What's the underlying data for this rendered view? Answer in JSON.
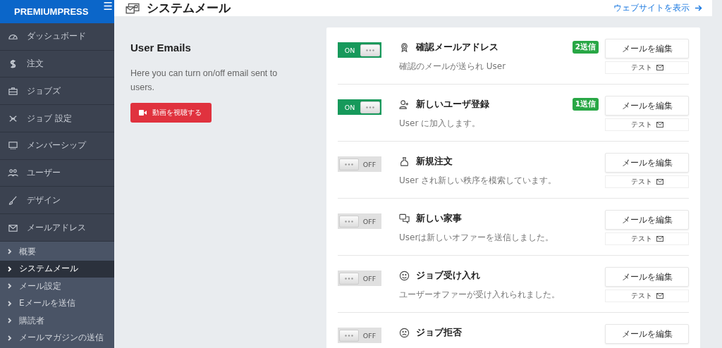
{
  "sidebar": {
    "logo": "PREMIUMPRESS",
    "menu_toggle": "☰",
    "items": [
      {
        "label": "ダッシュボード"
      },
      {
        "label": "注文"
      },
      {
        "label": "ジョブズ"
      },
      {
        "label": "ジョブ 設定"
      },
      {
        "label": "メンバーシップ"
      },
      {
        "label": "ユーザー"
      },
      {
        "label": "デザイン"
      },
      {
        "label": "メールアドレス"
      }
    ],
    "subitems": [
      {
        "label": "概要",
        "selected": false
      },
      {
        "label": "システムメール",
        "selected": true
      },
      {
        "label": "メール設定",
        "selected": false
      },
      {
        "label": "Eメールを送信",
        "selected": false
      },
      {
        "label": "購読者",
        "selected": false
      },
      {
        "label": "メールマガジンの送信",
        "selected": false
      }
    ]
  },
  "header": {
    "title": "システムメール",
    "link": "ウェブサイトを表示"
  },
  "intro": {
    "title": "User Emails",
    "text": "Here you can turn on/off email sent to users.",
    "video_button": "動画を視聴する"
  },
  "emails": [
    {
      "on": true,
      "toggle_label": "ON",
      "title": "確認メールアドレス",
      "description": "確認のメールが送られ User",
      "badge": "2送信",
      "edit": "メールを編集",
      "test": "テスト"
    },
    {
      "on": true,
      "toggle_label": "ON",
      "title": "新しいユーザ登録",
      "description": "User に加入します。",
      "badge": "1送信",
      "edit": "メールを編集",
      "test": "テスト"
    },
    {
      "on": false,
      "toggle_label": "OFF",
      "title": "新規注文",
      "description": "User され新しい秩序を模索しています。",
      "edit": "メールを編集",
      "test": "テスト"
    },
    {
      "on": false,
      "toggle_label": "OFF",
      "title": "新しい家事",
      "description": "Userは新しいオファーを送信しました。",
      "edit": "メールを編集",
      "test": "テスト"
    },
    {
      "on": false,
      "toggle_label": "OFF",
      "title": "ジョブ受け入れ",
      "description": "ユーザーオファーが受け入れられました。",
      "edit": "メールを編集",
      "test": "テスト"
    },
    {
      "on": false,
      "toggle_label": "OFF",
      "title": "ジョブ拒否",
      "edit": "メールを編集"
    }
  ]
}
